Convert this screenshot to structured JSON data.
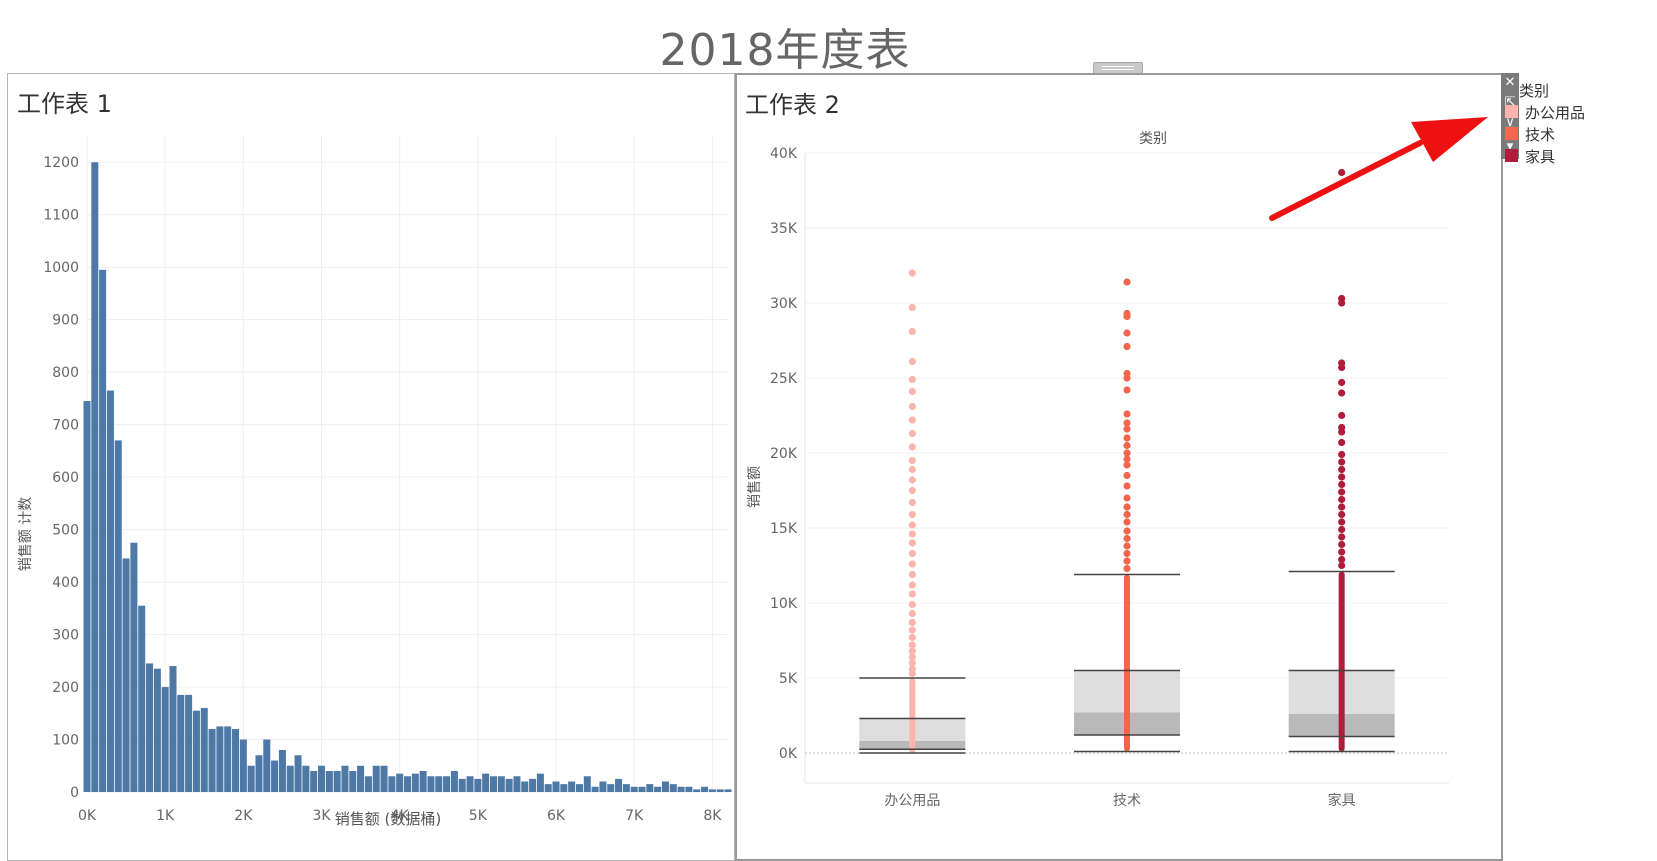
{
  "dashboard": {
    "title": "2018年度表"
  },
  "sheet1": {
    "title": "工作表 1",
    "chart_data": {
      "type": "bar",
      "xlabel": "销售额 (数据桶)",
      "ylabel": "销售额 计数",
      "x_ticks": [
        "0K",
        "1K",
        "2K",
        "3K",
        "4K",
        "5K",
        "6K",
        "7K",
        "8K"
      ],
      "y_ticks": [
        0,
        100,
        200,
        300,
        400,
        500,
        600,
        700,
        800,
        900,
        1000,
        1100,
        1200
      ],
      "ylim": [
        0,
        1250
      ],
      "xlim": [
        0,
        8200
      ],
      "bin_width": 100,
      "values": [
        745,
        1200,
        995,
        765,
        670,
        445,
        475,
        355,
        245,
        235,
        200,
        240,
        185,
        185,
        155,
        160,
        120,
        125,
        125,
        120,
        100,
        50,
        70,
        100,
        60,
        80,
        50,
        70,
        50,
        40,
        50,
        40,
        40,
        50,
        40,
        50,
        30,
        50,
        50,
        30,
        35,
        30,
        35,
        40,
        30,
        30,
        30,
        40,
        25,
        30,
        25,
        35,
        30,
        30,
        25,
        30,
        20,
        25,
        35,
        15,
        20,
        15,
        20,
        15,
        30,
        10,
        20,
        15,
        25,
        15,
        10,
        10,
        15,
        10,
        20,
        15,
        10,
        10,
        5,
        10,
        5,
        5,
        5
      ],
      "color": "#4e79a7"
    }
  },
  "sheet2": {
    "title": "工作表 2",
    "chart_data": {
      "type": "scatter",
      "subtype": "boxplot",
      "column_header": "类别",
      "ylabel": "销售额",
      "categories": [
        "办公用品",
        "技术",
        "家具"
      ],
      "y_ticks": [
        "0K",
        "5K",
        "10K",
        "15K",
        "20K",
        "25K",
        "30K",
        "35K",
        "40K"
      ],
      "ylim": [
        0,
        40000
      ],
      "series": [
        {
          "name": "办公用品",
          "color": "#fbb4ae",
          "box": {
            "whisker_low": 0,
            "q1": 250,
            "median": 800,
            "q3": 2300,
            "whisker_high": 5000
          },
          "outliers": [
            5300,
            5600,
            6000,
            6400,
            6800,
            7200,
            7700,
            8200,
            8700,
            9300,
            9900,
            10600,
            11200,
            11900,
            12600,
            13300,
            14000,
            14600,
            15200,
            15900,
            16700,
            17500,
            18200,
            18900,
            19500,
            20400,
            21300,
            22200,
            23100,
            24100,
            24900,
            26100,
            28100,
            29700,
            32000
          ]
        },
        {
          "name": "技术",
          "color": "#f1664c",
          "box": {
            "whisker_low": 100,
            "q1": 1200,
            "median": 2700,
            "q3": 5500,
            "whisker_high": 11900
          },
          "outliers": [
            12300,
            12800,
            13300,
            13800,
            14300,
            14800,
            15400,
            15900,
            16400,
            17000,
            17800,
            18500,
            19200,
            19600,
            20000,
            20500,
            21000,
            21600,
            22000,
            22600,
            24200,
            25000,
            25300,
            27100,
            28000,
            29100,
            29300,
            31400
          ]
        },
        {
          "name": "家具",
          "color": "#b01c3c",
          "box": {
            "whisker_low": 100,
            "q1": 1100,
            "median": 2600,
            "q3": 5500,
            "whisker_high": 12100
          },
          "outliers": [
            12500,
            12900,
            13400,
            13900,
            14400,
            14900,
            15400,
            15900,
            16400,
            16900,
            17400,
            17900,
            18400,
            18900,
            19400,
            19900,
            20700,
            21400,
            21700,
            22500,
            24000,
            24700,
            25700,
            26000,
            30000,
            30300,
            38700
          ]
        }
      ]
    }
  },
  "legend": {
    "title": "类别",
    "items": [
      {
        "label": "办公用品",
        "color": "#fbb4ae"
      },
      {
        "label": "技术",
        "color": "#f1664c"
      },
      {
        "label": "家具",
        "color": "#b01c3c"
      }
    ]
  },
  "toolbar": {
    "close": "✕",
    "popout": "⇱",
    "filter": "⊻",
    "more": "▾"
  }
}
